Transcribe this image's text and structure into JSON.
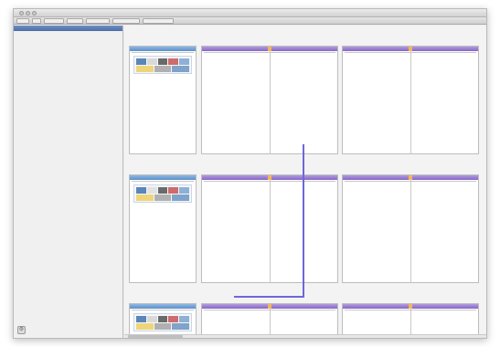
{
  "window": {
    "title": ""
  },
  "toolbar": {
    "buttons": [
      "",
      "",
      "",
      "",
      "",
      "",
      ""
    ]
  },
  "sidebar": {
    "header": "",
    "items": [
      {
        "label": ""
      },
      {
        "label": ""
      },
      {
        "label": ""
      },
      {
        "label": ""
      },
      {
        "label": ""
      }
    ]
  },
  "rows": [
    {
      "label": ""
    },
    {
      "label": ""
    },
    {
      "label": ""
    }
  ],
  "cards": {
    "blue_header": "",
    "purple_header": ""
  },
  "colors": {
    "accent_blue": "#5c8ec7",
    "accent_purple": "#8466c4",
    "connector": "#6d68d8"
  }
}
